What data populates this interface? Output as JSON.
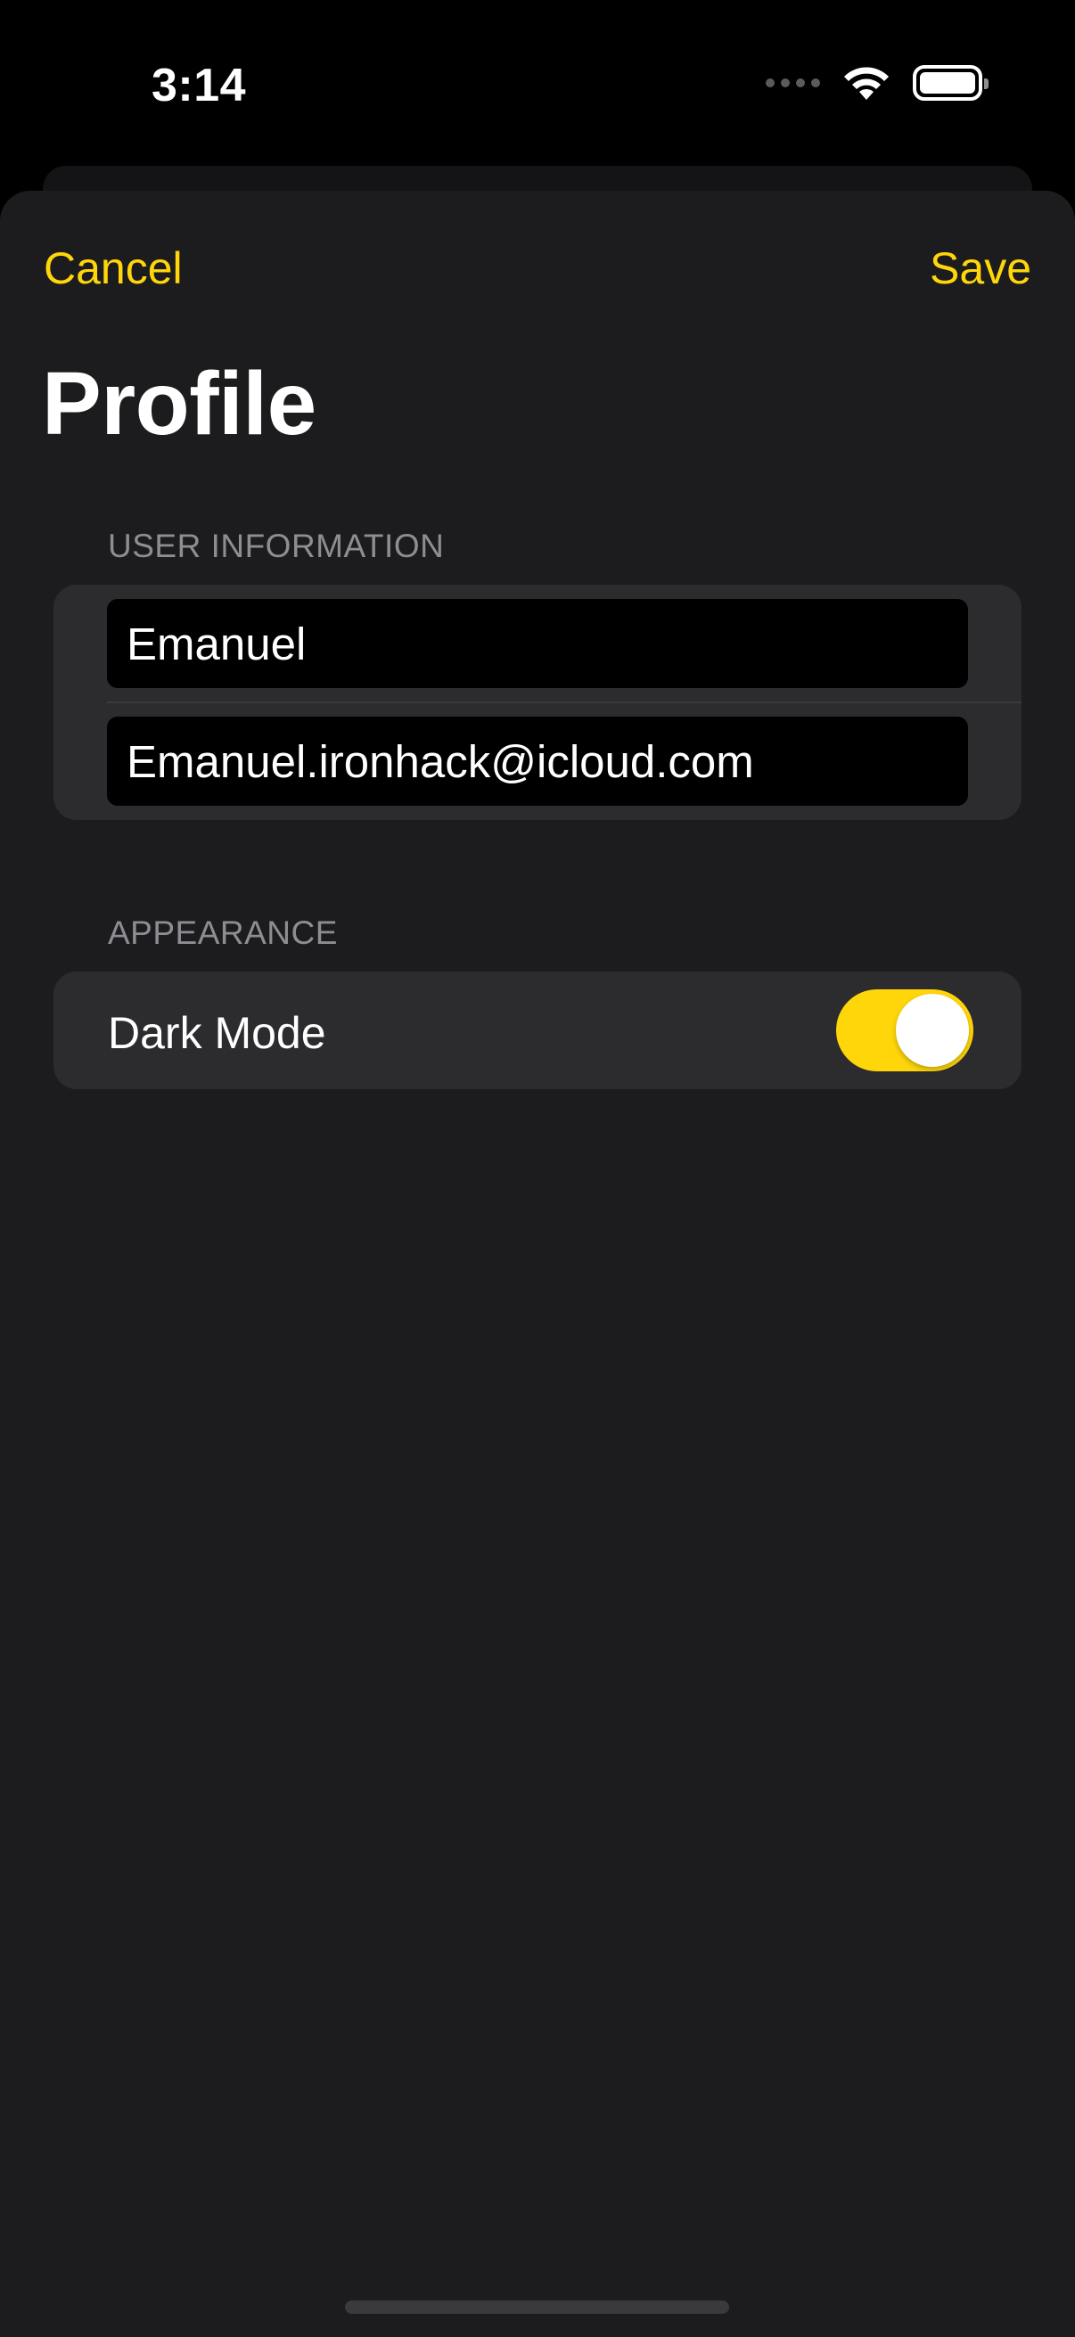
{
  "status_bar": {
    "time": "3:14"
  },
  "nav": {
    "cancel_label": "Cancel",
    "save_label": "Save"
  },
  "title": "Profile",
  "user_information": {
    "header": "USER INFORMATION",
    "name_value": "Emanuel",
    "email_value": "Emanuel.ironhack@icloud.com"
  },
  "appearance": {
    "header": "APPEARANCE",
    "dark_mode_label": "Dark Mode",
    "dark_mode_on": true
  },
  "colors": {
    "accent": "#ffd60a",
    "sheet_background": "#1c1c1e",
    "group_background": "#2c2c2e"
  },
  "icons": [
    "cellular-signal-icon",
    "wifi-icon",
    "battery-icon"
  ]
}
